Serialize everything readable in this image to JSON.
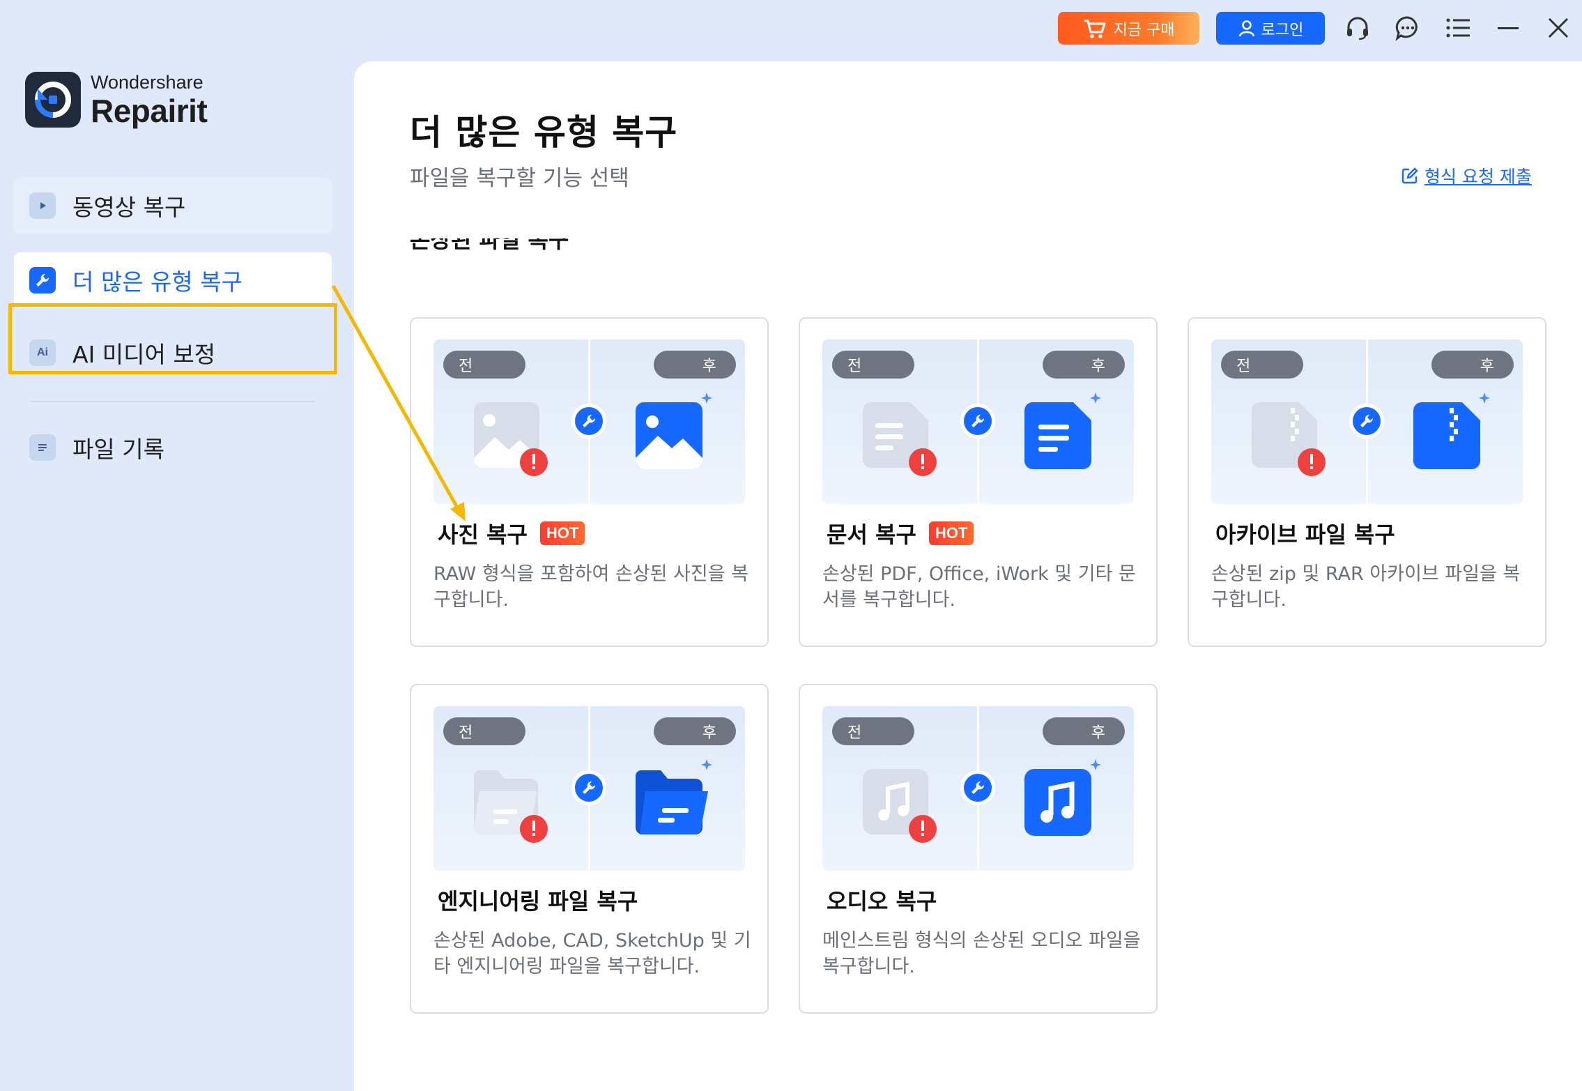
{
  "topbar": {
    "buy_label": "지금 구매",
    "login_label": "로그인",
    "icons": [
      "headset-icon",
      "chat-icon",
      "menu-list-icon",
      "minimize-icon",
      "close-icon"
    ]
  },
  "brand": {
    "sub": "Wondershare",
    "main": "Repairit"
  },
  "sidebar": {
    "items": [
      {
        "label": "동영상 복구",
        "icon": "video-icon"
      },
      {
        "label": "더 많은 유형 복구",
        "icon": "wrench-icon",
        "active": true
      },
      {
        "label": "AI 미디어 보정",
        "icon": "ai-icon"
      },
      {
        "label": "파일 기록",
        "icon": "file-list-icon"
      }
    ]
  },
  "main": {
    "title": "더 많은 유형 복구",
    "subtitle": "파일을 복구할 기능 선택",
    "request_link": "형식 요청 제출",
    "section_label": "손상된 파일 복구",
    "before_label": "전",
    "after_label": "후",
    "hot_label": "HOT",
    "cards": [
      {
        "title": "사진 복구",
        "hot": true,
        "desc": "RAW 형식을 포함하여 손상된 사진을 복구합니다.",
        "icon": "photo-icon"
      },
      {
        "title": "문서 복구",
        "hot": true,
        "desc": "손상된 PDF, Office, iWork 및 기타 문서를 복구합니다.",
        "icon": "document-icon"
      },
      {
        "title": "아카이브 파일 복구",
        "hot": false,
        "desc": "손상된 zip 및 RAR 아카이브 파일을 복구합니다.",
        "icon": "archive-icon"
      },
      {
        "title": "엔지니어링 파일 복구",
        "hot": false,
        "desc": "손상된 Adobe, CAD, SketchUp 및 기타 엔지니어링 파일을 복구합니다.",
        "icon": "folder-icon"
      },
      {
        "title": "오디오 복구",
        "hot": false,
        "desc": "메인스트림 형식의 손상된 오디오 파일을 복구합니다.",
        "icon": "audio-icon"
      }
    ]
  },
  "colors": {
    "accent": "#1668ff",
    "buy": "#ff5a1f",
    "highlight": "#f5b800",
    "sidebar_bg": "#dfe9fa"
  }
}
